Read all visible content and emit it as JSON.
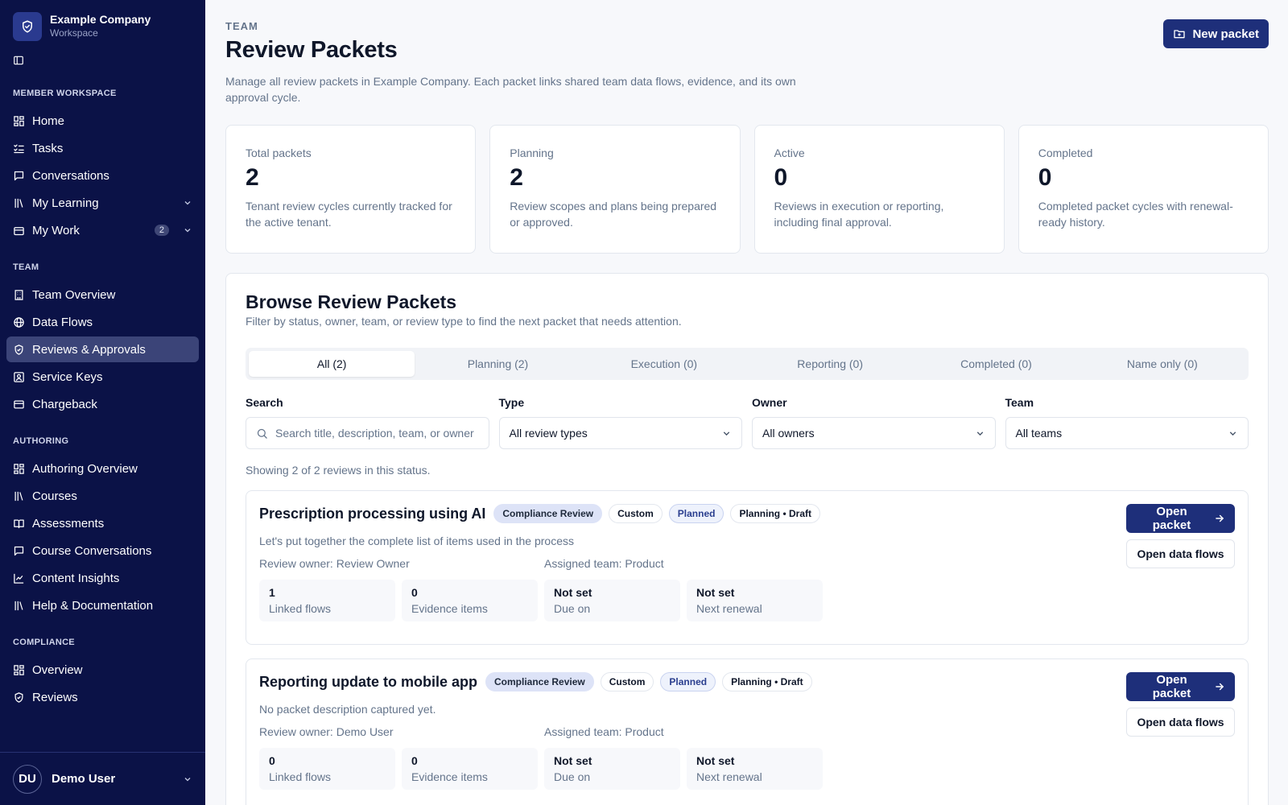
{
  "brand": {
    "name": "Example Company",
    "sub": "Workspace"
  },
  "nav": {
    "sections": {
      "member": "MEMBER WORKSPACE",
      "team": "TEAM",
      "authoring": "AUTHORING",
      "compliance": "COMPLIANCE"
    },
    "home": "Home",
    "tasks": "Tasks",
    "conversations": "Conversations",
    "my_learning": "My Learning",
    "my_work": "My Work",
    "my_work_badge": "2",
    "team_overview": "Team Overview",
    "data_flows": "Data Flows",
    "reviews_approvals": "Reviews & Approvals",
    "service_keys": "Service Keys",
    "chargeback": "Chargeback",
    "authoring_overview": "Authoring Overview",
    "courses": "Courses",
    "assessments": "Assessments",
    "course_conversations": "Course Conversations",
    "content_insights": "Content Insights",
    "help_docs": "Help & Documentation",
    "compliance_overview": "Overview",
    "compliance_reviews": "Reviews"
  },
  "user": {
    "initials": "DU",
    "name": "Demo User"
  },
  "header": {
    "eyebrow": "TEAM",
    "title": "Review Packets",
    "description": "Manage all review packets in Example Company. Each packet links shared team data flows, evidence, and its own approval cycle.",
    "new_packet": "New packet"
  },
  "stats": [
    {
      "label": "Total packets",
      "value": "2",
      "desc": "Tenant review cycles currently tracked for the active tenant."
    },
    {
      "label": "Planning",
      "value": "2",
      "desc": "Review scopes and plans being prepared or approved."
    },
    {
      "label": "Active",
      "value": "0",
      "desc": "Reviews in execution or reporting, including final approval."
    },
    {
      "label": "Completed",
      "value": "0",
      "desc": "Completed packet cycles with renewal-ready history."
    }
  ],
  "browse": {
    "title": "Browse Review Packets",
    "subtitle": "Filter by status, owner, team, or review type to find the next packet that needs attention.",
    "tabs": [
      "All (2)",
      "Planning (2)",
      "Execution (0)",
      "Reporting (0)",
      "Completed (0)",
      "Name only (0)"
    ],
    "filters": {
      "search_label": "Search",
      "search_placeholder": "Search title, description, team, or owner",
      "type_label": "Type",
      "type_value": "All review types",
      "owner_label": "Owner",
      "owner_value": "All owners",
      "team_label": "Team",
      "team_value": "All teams"
    },
    "showing": "Showing 2 of 2 reviews in this status."
  },
  "packets": [
    {
      "title": "Prescription processing using AI",
      "pills": [
        "Compliance Review",
        "Custom",
        "Planned",
        "Planning • Draft"
      ],
      "description": "Let's put together the complete list of items used in the process",
      "owner": "Review owner: Review Owner",
      "team": "Assigned team: Product",
      "metrics": [
        {
          "value": "1",
          "label": "Linked flows"
        },
        {
          "value": "0",
          "label": "Evidence items"
        },
        {
          "value": "Not set",
          "label": "Due on"
        },
        {
          "value": "Not set",
          "label": "Next renewal"
        }
      ],
      "open_packet": "Open packet",
      "open_flows": "Open data flows"
    },
    {
      "title": "Reporting update to mobile app",
      "pills": [
        "Compliance Review",
        "Custom",
        "Planned",
        "Planning • Draft"
      ],
      "description": "No packet description captured yet.",
      "owner": "Review owner: Demo User",
      "team": "Assigned team: Product",
      "metrics": [
        {
          "value": "0",
          "label": "Linked flows"
        },
        {
          "value": "0",
          "label": "Evidence items"
        },
        {
          "value": "Not set",
          "label": "Due on"
        },
        {
          "value": "Not set",
          "label": "Next renewal"
        }
      ],
      "open_packet": "Open packet",
      "open_flows": "Open data flows"
    }
  ]
}
